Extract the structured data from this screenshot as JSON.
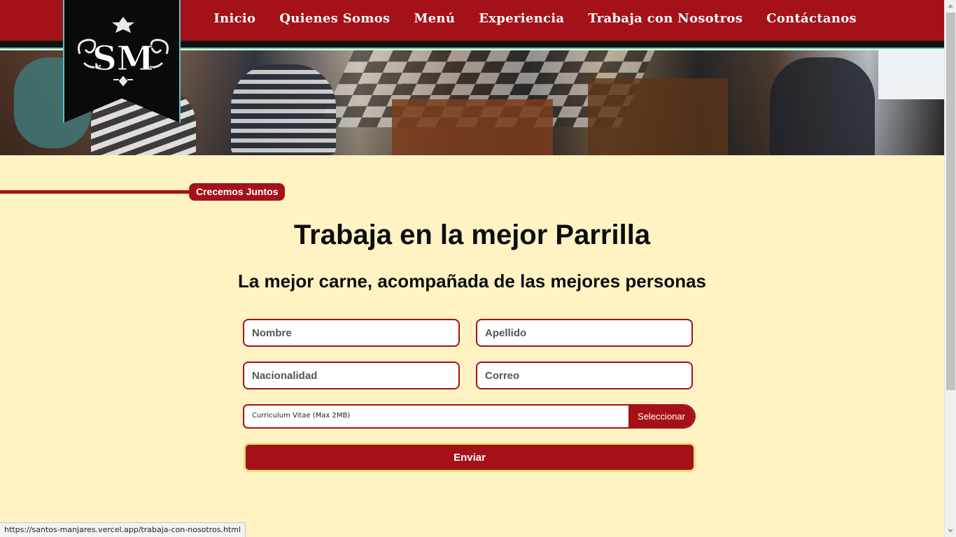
{
  "nav": {
    "items": [
      "Inicio",
      "Quienes Somos",
      "Menú",
      "Experiencia",
      "Trabaja con Nosotros",
      "Contáctanos"
    ]
  },
  "logo": {
    "text": "SM"
  },
  "section": {
    "tag": "Crecemos Juntos"
  },
  "main": {
    "title": "Trabaja en la mejor Parrilla",
    "subtitle": "La mejor carne, acompañada de las mejores personas"
  },
  "form": {
    "nombre_placeholder": "Nombre",
    "apellido_placeholder": "Apellido",
    "nacionalidad_placeholder": "Nacionalidad",
    "correo_placeholder": "Correo",
    "file_label": "Curriculum Vitae (Max 2MB)",
    "file_button": "Seleccionar",
    "submit_label": "Enviar"
  },
  "status": {
    "url": "https://santos-manjares.vercel.app/trabaja-con-nosotros.html"
  },
  "colors": {
    "brand_red": "#a51118",
    "background": "#fff3c4",
    "accent_teal": "#53c4cf"
  }
}
